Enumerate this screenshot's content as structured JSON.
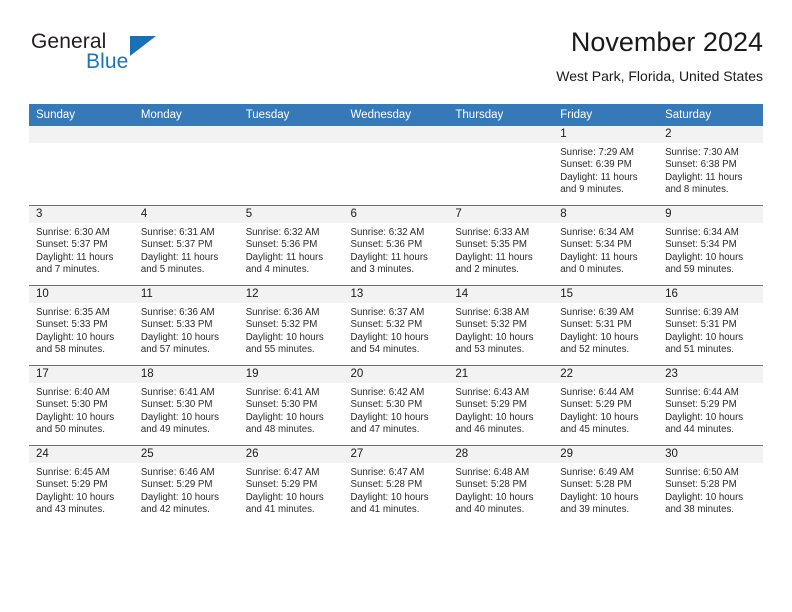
{
  "brand": {
    "name_part1": "General",
    "name_part2": "Blue",
    "logo_icon": "triangle-logo-icon",
    "colors": {
      "general_text": "#231f20",
      "blue_text": "#1b75bb",
      "triangle": "#1b6fb5"
    }
  },
  "header": {
    "title": "November 2024",
    "subtitle": "West Park, Florida, United States"
  },
  "theme": {
    "header_row_bg": "#3679b9",
    "header_row_text": "#ffffff",
    "daynum_bar_bg": "#f2f2f2",
    "cell_bg": "#ffffff",
    "grid_line": "#3679b9"
  },
  "weekday_headers": [
    "Sunday",
    "Monday",
    "Tuesday",
    "Wednesday",
    "Thursday",
    "Friday",
    "Saturday"
  ],
  "labels": {
    "sunrise_prefix": "Sunrise:",
    "sunset_prefix": "Sunset:",
    "daylight_prefix": "Daylight:"
  },
  "weeks": [
    [
      {
        "day": "",
        "sunrise": "",
        "sunset": "",
        "daylight_line1": "",
        "daylight_line2": "",
        "empty": true
      },
      {
        "day": "",
        "sunrise": "",
        "sunset": "",
        "daylight_line1": "",
        "daylight_line2": "",
        "empty": true
      },
      {
        "day": "",
        "sunrise": "",
        "sunset": "",
        "daylight_line1": "",
        "daylight_line2": "",
        "empty": true
      },
      {
        "day": "",
        "sunrise": "",
        "sunset": "",
        "daylight_line1": "",
        "daylight_line2": "",
        "empty": true
      },
      {
        "day": "",
        "sunrise": "",
        "sunset": "",
        "daylight_line1": "",
        "daylight_line2": "",
        "empty": true
      },
      {
        "day": "1",
        "sunrise": "Sunrise: 7:29 AM",
        "sunset": "Sunset: 6:39 PM",
        "daylight_line1": "Daylight: 11 hours",
        "daylight_line2": "and 9 minutes.",
        "empty": false
      },
      {
        "day": "2",
        "sunrise": "Sunrise: 7:30 AM",
        "sunset": "Sunset: 6:38 PM",
        "daylight_line1": "Daylight: 11 hours",
        "daylight_line2": "and 8 minutes.",
        "empty": false
      }
    ],
    [
      {
        "day": "3",
        "sunrise": "Sunrise: 6:30 AM",
        "sunset": "Sunset: 5:37 PM",
        "daylight_line1": "Daylight: 11 hours",
        "daylight_line2": "and 7 minutes.",
        "empty": false
      },
      {
        "day": "4",
        "sunrise": "Sunrise: 6:31 AM",
        "sunset": "Sunset: 5:37 PM",
        "daylight_line1": "Daylight: 11 hours",
        "daylight_line2": "and 5 minutes.",
        "empty": false
      },
      {
        "day": "5",
        "sunrise": "Sunrise: 6:32 AM",
        "sunset": "Sunset: 5:36 PM",
        "daylight_line1": "Daylight: 11 hours",
        "daylight_line2": "and 4 minutes.",
        "empty": false
      },
      {
        "day": "6",
        "sunrise": "Sunrise: 6:32 AM",
        "sunset": "Sunset: 5:36 PM",
        "daylight_line1": "Daylight: 11 hours",
        "daylight_line2": "and 3 minutes.",
        "empty": false
      },
      {
        "day": "7",
        "sunrise": "Sunrise: 6:33 AM",
        "sunset": "Sunset: 5:35 PM",
        "daylight_line1": "Daylight: 11 hours",
        "daylight_line2": "and 2 minutes.",
        "empty": false
      },
      {
        "day": "8",
        "sunrise": "Sunrise: 6:34 AM",
        "sunset": "Sunset: 5:34 PM",
        "daylight_line1": "Daylight: 11 hours",
        "daylight_line2": "and 0 minutes.",
        "empty": false
      },
      {
        "day": "9",
        "sunrise": "Sunrise: 6:34 AM",
        "sunset": "Sunset: 5:34 PM",
        "daylight_line1": "Daylight: 10 hours",
        "daylight_line2": "and 59 minutes.",
        "empty": false
      }
    ],
    [
      {
        "day": "10",
        "sunrise": "Sunrise: 6:35 AM",
        "sunset": "Sunset: 5:33 PM",
        "daylight_line1": "Daylight: 10 hours",
        "daylight_line2": "and 58 minutes.",
        "empty": false
      },
      {
        "day": "11",
        "sunrise": "Sunrise: 6:36 AM",
        "sunset": "Sunset: 5:33 PM",
        "daylight_line1": "Daylight: 10 hours",
        "daylight_line2": "and 57 minutes.",
        "empty": false
      },
      {
        "day": "12",
        "sunrise": "Sunrise: 6:36 AM",
        "sunset": "Sunset: 5:32 PM",
        "daylight_line1": "Daylight: 10 hours",
        "daylight_line2": "and 55 minutes.",
        "empty": false
      },
      {
        "day": "13",
        "sunrise": "Sunrise: 6:37 AM",
        "sunset": "Sunset: 5:32 PM",
        "daylight_line1": "Daylight: 10 hours",
        "daylight_line2": "and 54 minutes.",
        "empty": false
      },
      {
        "day": "14",
        "sunrise": "Sunrise: 6:38 AM",
        "sunset": "Sunset: 5:32 PM",
        "daylight_line1": "Daylight: 10 hours",
        "daylight_line2": "and 53 minutes.",
        "empty": false
      },
      {
        "day": "15",
        "sunrise": "Sunrise: 6:39 AM",
        "sunset": "Sunset: 5:31 PM",
        "daylight_line1": "Daylight: 10 hours",
        "daylight_line2": "and 52 minutes.",
        "empty": false
      },
      {
        "day": "16",
        "sunrise": "Sunrise: 6:39 AM",
        "sunset": "Sunset: 5:31 PM",
        "daylight_line1": "Daylight: 10 hours",
        "daylight_line2": "and 51 minutes.",
        "empty": false
      }
    ],
    [
      {
        "day": "17",
        "sunrise": "Sunrise: 6:40 AM",
        "sunset": "Sunset: 5:30 PM",
        "daylight_line1": "Daylight: 10 hours",
        "daylight_line2": "and 50 minutes.",
        "empty": false
      },
      {
        "day": "18",
        "sunrise": "Sunrise: 6:41 AM",
        "sunset": "Sunset: 5:30 PM",
        "daylight_line1": "Daylight: 10 hours",
        "daylight_line2": "and 49 minutes.",
        "empty": false
      },
      {
        "day": "19",
        "sunrise": "Sunrise: 6:41 AM",
        "sunset": "Sunset: 5:30 PM",
        "daylight_line1": "Daylight: 10 hours",
        "daylight_line2": "and 48 minutes.",
        "empty": false
      },
      {
        "day": "20",
        "sunrise": "Sunrise: 6:42 AM",
        "sunset": "Sunset: 5:30 PM",
        "daylight_line1": "Daylight: 10 hours",
        "daylight_line2": "and 47 minutes.",
        "empty": false
      },
      {
        "day": "21",
        "sunrise": "Sunrise: 6:43 AM",
        "sunset": "Sunset: 5:29 PM",
        "daylight_line1": "Daylight: 10 hours",
        "daylight_line2": "and 46 minutes.",
        "empty": false
      },
      {
        "day": "22",
        "sunrise": "Sunrise: 6:44 AM",
        "sunset": "Sunset: 5:29 PM",
        "daylight_line1": "Daylight: 10 hours",
        "daylight_line2": "and 45 minutes.",
        "empty": false
      },
      {
        "day": "23",
        "sunrise": "Sunrise: 6:44 AM",
        "sunset": "Sunset: 5:29 PM",
        "daylight_line1": "Daylight: 10 hours",
        "daylight_line2": "and 44 minutes.",
        "empty": false
      }
    ],
    [
      {
        "day": "24",
        "sunrise": "Sunrise: 6:45 AM",
        "sunset": "Sunset: 5:29 PM",
        "daylight_line1": "Daylight: 10 hours",
        "daylight_line2": "and 43 minutes.",
        "empty": false
      },
      {
        "day": "25",
        "sunrise": "Sunrise: 6:46 AM",
        "sunset": "Sunset: 5:29 PM",
        "daylight_line1": "Daylight: 10 hours",
        "daylight_line2": "and 42 minutes.",
        "empty": false
      },
      {
        "day": "26",
        "sunrise": "Sunrise: 6:47 AM",
        "sunset": "Sunset: 5:29 PM",
        "daylight_line1": "Daylight: 10 hours",
        "daylight_line2": "and 41 minutes.",
        "empty": false
      },
      {
        "day": "27",
        "sunrise": "Sunrise: 6:47 AM",
        "sunset": "Sunset: 5:28 PM",
        "daylight_line1": "Daylight: 10 hours",
        "daylight_line2": "and 41 minutes.",
        "empty": false
      },
      {
        "day": "28",
        "sunrise": "Sunrise: 6:48 AM",
        "sunset": "Sunset: 5:28 PM",
        "daylight_line1": "Daylight: 10 hours",
        "daylight_line2": "and 40 minutes.",
        "empty": false
      },
      {
        "day": "29",
        "sunrise": "Sunrise: 6:49 AM",
        "sunset": "Sunset: 5:28 PM",
        "daylight_line1": "Daylight: 10 hours",
        "daylight_line2": "and 39 minutes.",
        "empty": false
      },
      {
        "day": "30",
        "sunrise": "Sunrise: 6:50 AM",
        "sunset": "Sunset: 5:28 PM",
        "daylight_line1": "Daylight: 10 hours",
        "daylight_line2": "and 38 minutes.",
        "empty": false
      }
    ]
  ]
}
